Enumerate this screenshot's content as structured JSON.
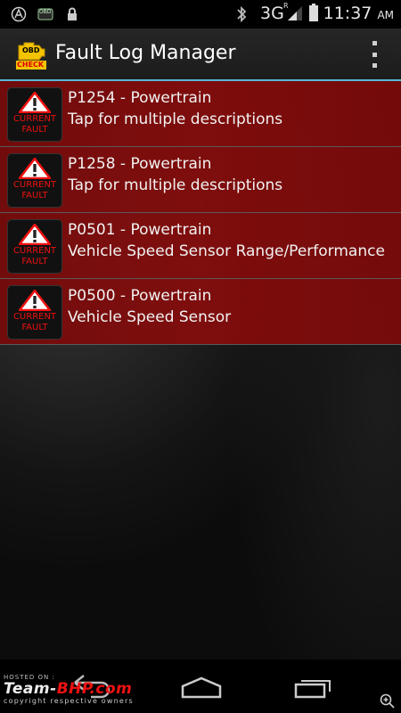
{
  "status_bar": {
    "network": "3G",
    "roaming": "R",
    "time": "11:37",
    "ampm": "AM",
    "obd_label": "OBD"
  },
  "action_bar": {
    "title": "Fault Log Manager",
    "icon_top": "OBD",
    "icon_bottom": "CHECK"
  },
  "faults": [
    {
      "badge_line1": "CURRENT",
      "badge_line2": "FAULT",
      "code": "P1254 - Powertrain",
      "description": "Tap for multiple descriptions"
    },
    {
      "badge_line1": "CURRENT",
      "badge_line2": "FAULT",
      "code": "P1258 - Powertrain",
      "description": "Tap for multiple descriptions"
    },
    {
      "badge_line1": "CURRENT",
      "badge_line2": "FAULT",
      "code": "P0501 - Powertrain",
      "description": "Vehicle Speed Sensor Range/Performance"
    },
    {
      "badge_line1": "CURRENT",
      "badge_line2": "FAULT",
      "code": "P0500 - Powertrain",
      "description": "Vehicle Speed Sensor"
    }
  ],
  "watermark": {
    "hosted": "HOSTED ON :",
    "brand_a": "Team-",
    "brand_b": "BHP",
    "brand_c": ".com",
    "copyright": "copyright respective owners"
  },
  "colors": {
    "accent": "#57b6d8",
    "row_bg": "#860c0c",
    "warning_red": "#e11111"
  },
  "icons": [
    "notification-a-icon",
    "obd-notification-icon",
    "lock-icon",
    "bluetooth-icon",
    "signal-icon",
    "battery-icon",
    "overflow-menu-icon",
    "back-icon",
    "home-icon",
    "recent-apps-icon",
    "zoom-icon"
  ]
}
